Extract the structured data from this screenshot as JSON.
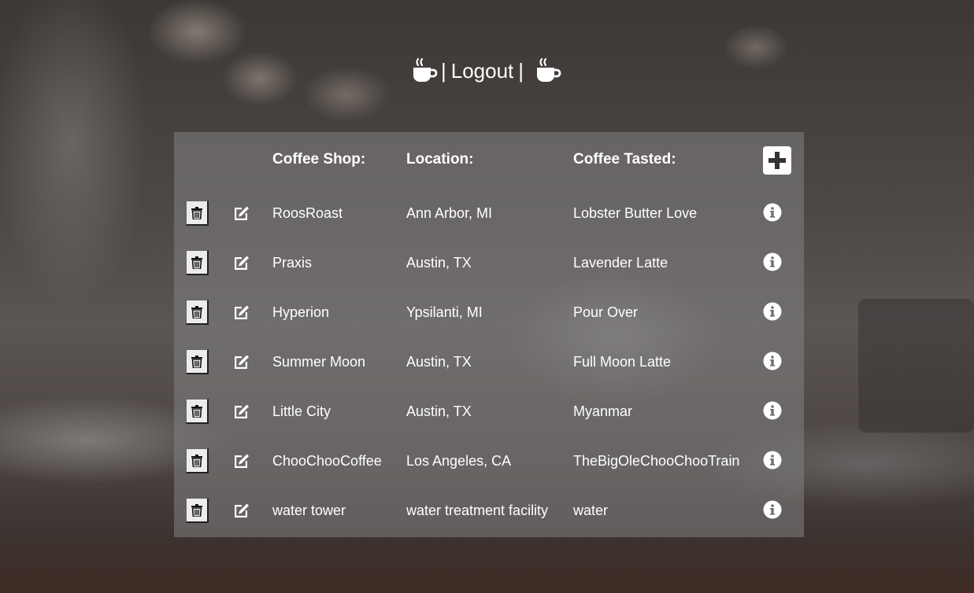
{
  "header": {
    "separator": "|",
    "logout_label": "Logout",
    "left_icon": "coffee-cup-icon",
    "right_icon": "coffee-cup-icon"
  },
  "table": {
    "headers": {
      "shop": "Coffee Shop:",
      "location": "Location:",
      "coffee": "Coffee Tasted:"
    },
    "add_icon": "plus-square-icon",
    "row_icons": {
      "delete": "trash-icon",
      "edit": "edit-icon",
      "info": "info-circle-icon"
    },
    "rows": [
      {
        "shop": "RoosRoast",
        "location": "Ann Arbor, MI",
        "coffee": "Lobster Butter Love"
      },
      {
        "shop": "Praxis",
        "location": "Austin, TX",
        "coffee": "Lavender Latte"
      },
      {
        "shop": "Hyperion",
        "location": "Ypsilanti, MI",
        "coffee": "Pour Over"
      },
      {
        "shop": "Summer Moon",
        "location": "Austin, TX",
        "coffee": "Full Moon Latte"
      },
      {
        "shop": "Little City",
        "location": "Austin, TX",
        "coffee": "Myanmar"
      },
      {
        "shop": "ChooChooCoffee",
        "location": "Los Angeles, CA",
        "coffee": "TheBigOleChooChooTrain"
      },
      {
        "shop": "water tower",
        "location": "water treatment facility",
        "coffee": "water"
      }
    ]
  },
  "colors": {
    "text": "#ffffff",
    "panel": "#828282",
    "button_face": "#ececec"
  }
}
